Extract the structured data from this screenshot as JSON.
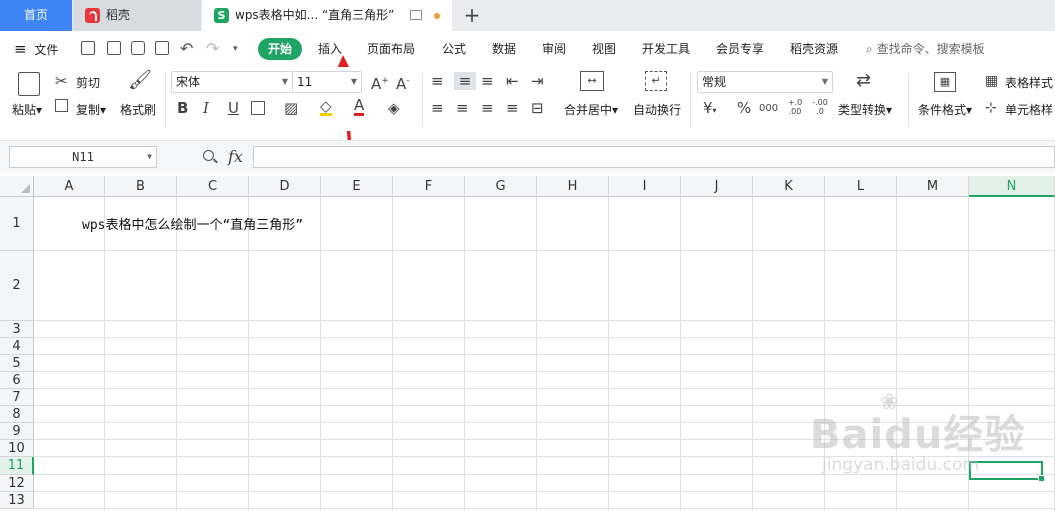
{
  "tabs": [
    {
      "label": "首页"
    },
    {
      "label": "稻壳"
    },
    {
      "label": "wps表格中如... “直角三角形”",
      "icon": "wps-sheet-icon",
      "accent": "#1fa463"
    }
  ],
  "menu": {
    "file": "文件",
    "items": [
      "开始",
      "插入",
      "页面布局",
      "公式",
      "数据",
      "审阅",
      "视图",
      "开发工具",
      "会员专享",
      "稻壳资源"
    ],
    "search_placeholder": "查找命令、搜索模板"
  },
  "ribbon": {
    "paste": "粘贴",
    "cut": "剪切",
    "copy": "复制",
    "format_painter": "格式刷",
    "font_name": "宋体",
    "font_size": "11",
    "bold": "B",
    "italic": "I",
    "underline": "U",
    "merge_center": "合并居中",
    "wrap_text": "自动换行",
    "number_format": "常规",
    "currency": "¥",
    "percent": "%",
    "thousands": "000",
    "dec_inc": "+.0 .00",
    "dec_dec": "-.00 .0",
    "type_convert": "类型转换",
    "cond_format": "条件格式",
    "table_style": "表格样式",
    "cell_style": "单元格样"
  },
  "formula_bar": {
    "name_box": "N11",
    "fx": "fx",
    "formula": ""
  },
  "sheet": {
    "columns": [
      "A",
      "B",
      "C",
      "D",
      "E",
      "F",
      "G",
      "H",
      "I",
      "J",
      "K",
      "L",
      "M",
      "N"
    ],
    "rows": [
      "1",
      "2",
      "3",
      "4",
      "5",
      "6",
      "7",
      "8",
      "9",
      "10",
      "11",
      "12",
      "13"
    ],
    "selected_column": "N",
    "selected_row": "11",
    "a1_text": "wps表格中怎么绘制一个“直角三角形”"
  },
  "watermark": {
    "brand": "Baidu经验",
    "url": "jingyan.baidu.com"
  },
  "colors": {
    "accent": "#1fa463",
    "home_tab": "#3f85f5",
    "arrow": "#e02020"
  }
}
